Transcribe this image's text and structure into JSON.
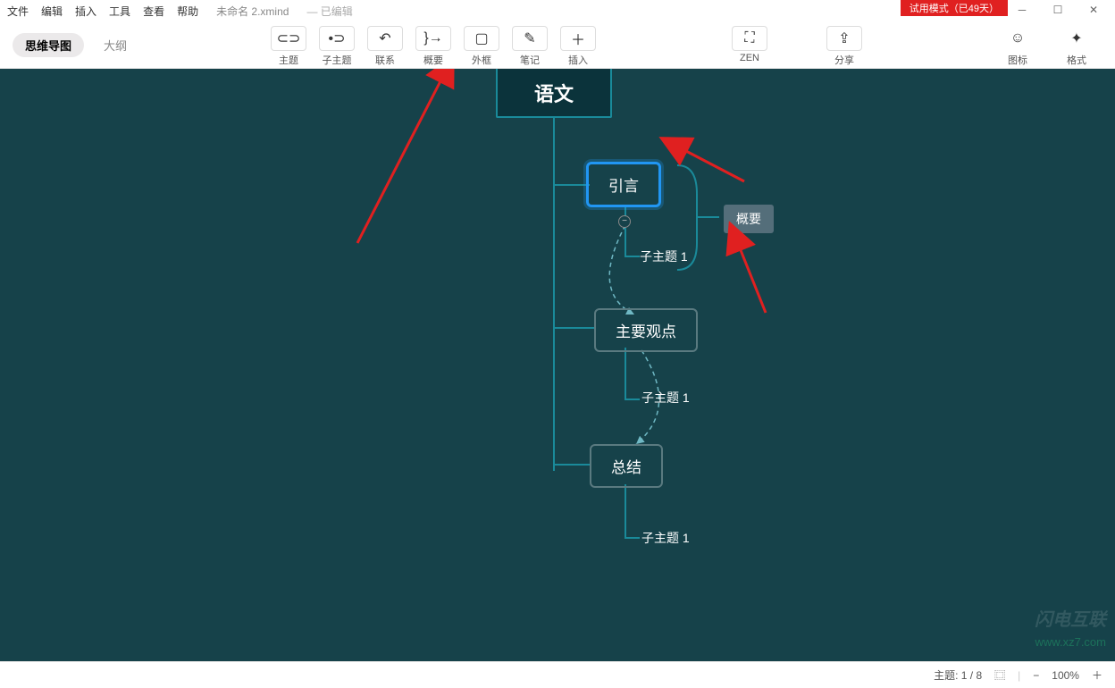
{
  "menu": {
    "file": "文件",
    "edit": "编辑",
    "insert": "插入",
    "tools": "工具",
    "view": "查看",
    "help": "帮助",
    "doc_title": "未命名 2.xmind",
    "edited": "— 已编辑",
    "trial": "试用模式（已49天）"
  },
  "view_tabs": {
    "mindmap": "思维导图",
    "outline": "大纲"
  },
  "toolbar": {
    "topic": "主题",
    "subtopic": "子主题",
    "relation": "联系",
    "summary": "概要",
    "boundary": "外框",
    "notes": "笔记",
    "insert": "插入",
    "zen": "ZEN",
    "share": "分享",
    "iconset": "图标",
    "format": "格式"
  },
  "mindmap": {
    "root": "语文",
    "n_intro": "引言",
    "n_intro_sub": "子主题 1",
    "n_main": "主要观点",
    "n_main_sub": "子主题 1",
    "n_conclusion": "总结",
    "n_conclusion_sub": "子主题 1",
    "summary_label": "概要"
  },
  "status": {
    "topic_count": "主题: 1 / 8",
    "zoom_label": "100%"
  },
  "watermark": {
    "brand": "闪电互联",
    "url": "www.xz7.com"
  }
}
